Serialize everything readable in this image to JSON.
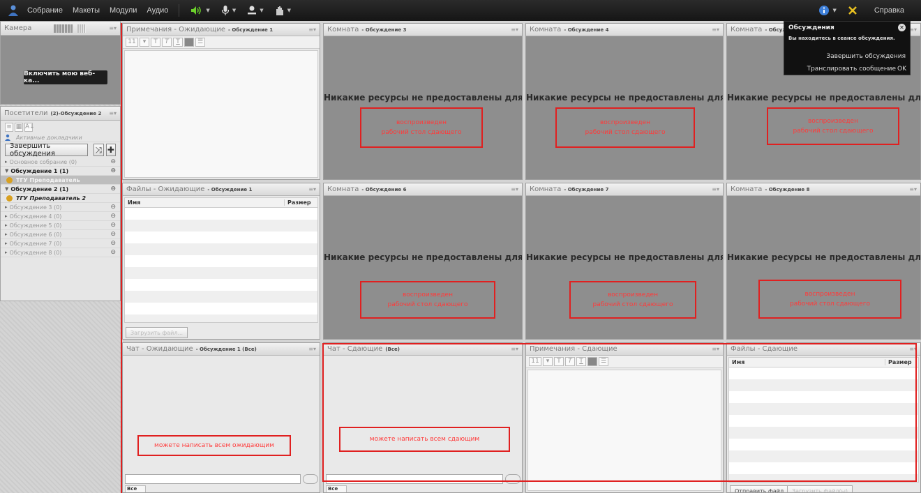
{
  "menu": [
    "Собрание",
    "Макеты",
    "Модули",
    "Аудио"
  ],
  "help": "Справка",
  "colors": {
    "annotation": "#e02020",
    "room_bg": "#8e8e8e",
    "topbar": "#1c1c1c"
  },
  "camera": {
    "title": "Камера",
    "button": "Включить мою веб-ка..."
  },
  "attendees": {
    "title": "Посетители",
    "subtitle": "(2)-Обсуждение 2",
    "active_speakers": "Активные докладчики",
    "end_button": "Завершить обсуждения",
    "groups": [
      {
        "label": "Основное собрание (0)",
        "state": "off"
      },
      {
        "label": "Обсуждение 1 (1)",
        "state": "on"
      },
      {
        "label": "ТГУ Преподаватель",
        "state": "highlight"
      },
      {
        "label": "Обсуждение 2 (1)",
        "state": "on"
      },
      {
        "label": "ТГУ Преподаватель 2",
        "state": "user"
      },
      {
        "label": "Обсуждение 3 (0)",
        "state": "off"
      },
      {
        "label": "Обсуждение 4 (0)",
        "state": "off"
      },
      {
        "label": "Обсуждение 5 (0)",
        "state": "off"
      },
      {
        "label": "Обсуждение 6 (0)",
        "state": "off"
      },
      {
        "label": "Обсуждение 7 (0)",
        "state": "off"
      },
      {
        "label": "Обсуждение 8 (0)",
        "state": "off"
      }
    ]
  },
  "notes_waiting": {
    "title": "Примечания - Ожидающие",
    "session": "- Обсуждение 1",
    "font_size": "11"
  },
  "files_waiting": {
    "title": "Файлы - Ожидающие",
    "session": "- Обсуждение 1",
    "col_name": "Имя",
    "col_size": "Размер",
    "upload": "Загрузить файл..."
  },
  "chat_waiting": {
    "title": "Чат - Ожидающие",
    "session": "- Обсуждение 1 (Все)",
    "note": "можете написать всем ожидающим",
    "tab": "Все"
  },
  "chat_passing": {
    "title": "Чат - Сдающие",
    "session": "(Все)",
    "note": "можете написать всем сдающим",
    "tab": "Все"
  },
  "notes_passing": {
    "title": "Примечания - Сдающие",
    "font_size": "11"
  },
  "files_passing": {
    "title": "Файлы - Сдающие",
    "col_name": "Имя",
    "col_size": "Размер",
    "upload": "Отправить файл...",
    "download": "Загрузить файл(ы)"
  },
  "rooms": [
    {
      "title": "Комната",
      "session": "- Обсуждение 3",
      "message": "Никакие ресурсы не предоставлены для совм...",
      "note": "воспроизведен\nрабочий стол сдающего"
    },
    {
      "title": "Комната",
      "session": "- Обсуждение 4",
      "message": "Никакие ресурсы не предоставлены для совм...",
      "note": "воспроизведен\nрабочий стол сдающего"
    },
    {
      "title": "Комната",
      "session": "- Обсужд",
      "message": "Никакие ресурсы не предоставлены для совм...",
      "note": "воспроизведен\nрабочий стол сдающего"
    },
    {
      "title": "Комната",
      "session": "- Обсуждение 6",
      "message": "Никакие ресурсы не предоставлены для совм...",
      "note": "воспроизведен\nрабочий стол сдающего"
    },
    {
      "title": "Комната",
      "session": "- Обсуждение 7",
      "message": "Никакие ресурсы не предоставлены для совм...",
      "note": "воспроизведен\nрабочий стол сдающего"
    },
    {
      "title": "Комната",
      "session": "- Обсуждение 8",
      "message": "Никакие ресурсы не предоставлены для совм...",
      "note": "воспроизведен\nрабочий стол сдающего"
    }
  ],
  "popup": {
    "title": "Обсуждения",
    "message": "Вы находитесь в сеансе обсуждения.",
    "end": "Завершить обсуждения",
    "broadcast": "Транслировать сообщение",
    "ok": "OK"
  }
}
